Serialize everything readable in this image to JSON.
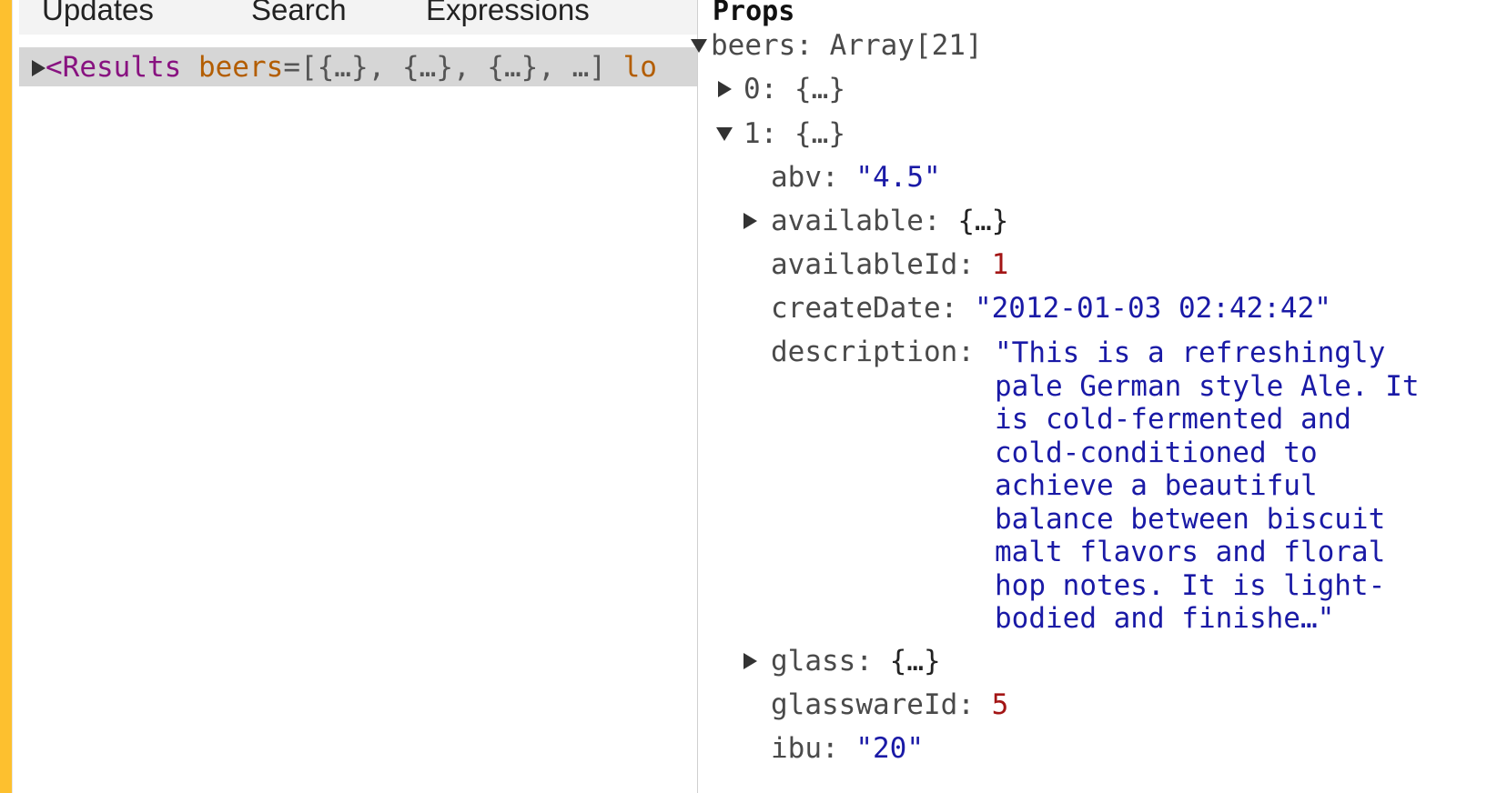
{
  "tabs": [
    {
      "label": "Updates"
    },
    {
      "label": "Search"
    },
    {
      "label": "Expressions"
    }
  ],
  "tree": {
    "selected_row": {
      "tag_open": "<Results",
      "attr_name": "beers",
      "attr_eq": "=",
      "attr_value": "[{…}, {…}, {…}, …]",
      "next_attr_fragment": "lo"
    }
  },
  "props": {
    "title": "Props",
    "beers_key": "beers:",
    "beers_value": "Array[21]",
    "item0_key": "0:",
    "item0_value": "{…}",
    "item1_key": "1:",
    "item1_value": "{…}",
    "fields": {
      "abv": {
        "key": "abv:",
        "value": "\"4.5\""
      },
      "available": {
        "key": "available:",
        "value": "{…}"
      },
      "availableId": {
        "key": "availableId:",
        "value": "1"
      },
      "createDate": {
        "key": "createDate:",
        "value": "\"2012-01-03 02:42:42\""
      },
      "description": {
        "key": "description:",
        "value": "\"This is a refreshingly\npale German style Ale. It\nis cold-fermented and\ncold-conditioned to\nachieve a beautiful\nbalance between biscuit\nmalt flavors and floral\nhop notes. It is light-\nbodied and finishe…\""
      },
      "glass": {
        "key": "glass:",
        "value": "{…}"
      },
      "glasswareId": {
        "key": "glasswareId:",
        "value": "5"
      },
      "ibu": {
        "key": "ibu:",
        "value": "\"20\""
      }
    }
  },
  "colors": {
    "accent": "#fdc02f",
    "tag": "#881280",
    "attr": "#b35d00",
    "string": "#1a1aa6",
    "number": "#a31515",
    "selected_row_bg": "#d6d6d6"
  }
}
